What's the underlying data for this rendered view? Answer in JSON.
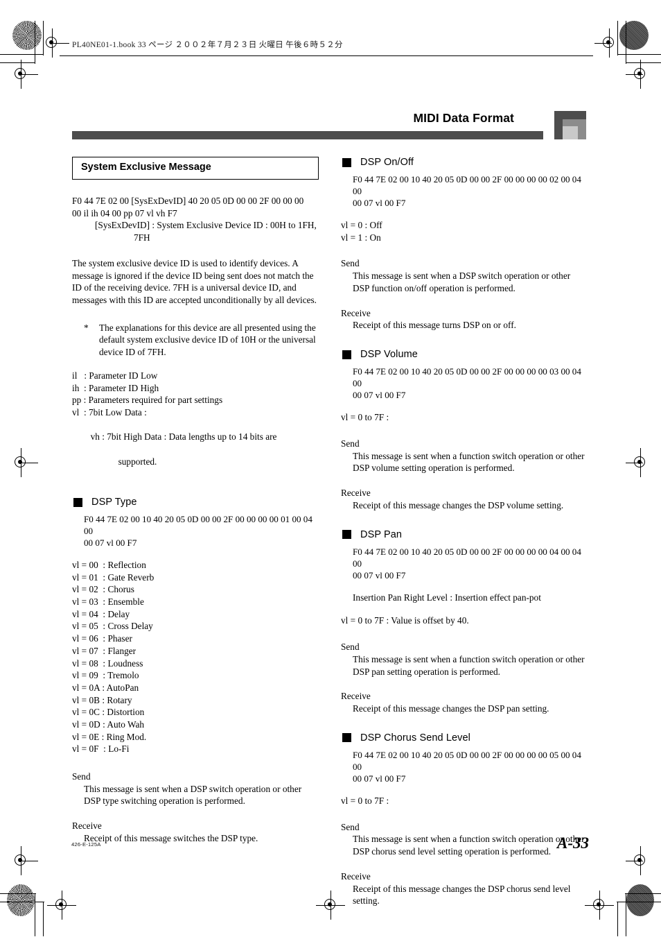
{
  "slug": "PL40NE01-1.book   33 ページ   ２００２年７月２３日   火曜日   午後６時５２分",
  "running_head": {
    "title": "MIDI Data Format"
  },
  "footer": {
    "code": "426-E-125A",
    "page": "A-33"
  },
  "left_column": {
    "section_heading": "System Exclusive Message",
    "sysex_hex_line1": "F0 44 7E 02 00 [SysExDevID] 40 20 05 0D 00 00 2F 00 00 00",
    "sysex_hex_line2": "00 il ih 04 00 pp 07 vl vh F7",
    "devid_line1": "[SysExDevID] : System Exclusive Device ID : 00H to 1FH,",
    "devid_line2": "7FH",
    "description": "The system exclusive device ID is used to identify devices. A message is ignored if the device ID being sent does not match the ID of the receiving device. 7FH is a universal device ID, and messages with this ID are accepted unconditionally by all devices.",
    "note_marker": "*",
    "note_text": "The explanations for this device are all presented using the default system exclusive device ID of 10H or the universal device ID of 7FH.",
    "param_defs": [
      "il   : Parameter ID Low",
      "ih  : Parameter ID High",
      "pp : Parameters required for part settings",
      "vl  : 7bit Low Data :"
    ],
    "param_def_vh_main": "vh : 7bit High Data : Data lengths up to 14 bits are",
    "param_def_vh_cont": "supported.",
    "dsp_type": {
      "heading": "DSP Type",
      "hex_line1": "F0 44 7E 02 00 10 40 20 05 0D 00 00 2F 00 00 00 00 01 00 04 00",
      "hex_line2": "00 07 vl 00 F7",
      "values": [
        "vl = 00  : Reflection",
        "vl = 01  : Gate Reverb",
        "vl = 02  : Chorus",
        "vl = 03  : Ensemble",
        "vl = 04  : Delay",
        "vl = 05  : Cross Delay",
        "vl = 06  : Phaser",
        "vl = 07  : Flanger",
        "vl = 08  : Loudness",
        "vl = 09  : Tremolo",
        "vl = 0A : AutoPan",
        "vl = 0B : Rotary",
        "vl = 0C : Distortion",
        "vl = 0D : Auto Wah",
        "vl = 0E : Ring Mod.",
        "vl = 0F  : Lo-Fi"
      ],
      "send_label": "Send",
      "send_text": "This message is sent when a DSP switch operation or other DSP type switching operation is performed.",
      "receive_label": "Receive",
      "receive_text": "Receipt of this message switches the DSP type."
    }
  },
  "right_column": {
    "dsp_onoff": {
      "heading": "DSP On/Off",
      "hex_line1": "F0 44 7E 02 00 10 40 20 05 0D 00 00 2F 00 00 00 00 02 00 04 00",
      "hex_line2": "00 07 vl 00 F7",
      "values": [
        "vl = 0 : Off",
        "vl = 1 : On"
      ],
      "send_label": "Send",
      "send_text": "This message is sent when a DSP switch operation or other DSP function on/off operation is performed.",
      "receive_label": "Receive",
      "receive_text": "Receipt of this message turns DSP on or off."
    },
    "dsp_volume": {
      "heading": "DSP Volume",
      "hex_line1": "F0 44 7E 02 00 10 40 20 05 0D 00 00 2F 00 00 00 00 03 00 04 00",
      "hex_line2": "00 07 vl 00 F7",
      "values": [
        "vl = 0 to 7F :"
      ],
      "send_label": "Send",
      "send_text": "This message is sent when a function switch operation or other DSP volume setting operation is performed.",
      "receive_label": "Receive",
      "receive_text": "Receipt of this message changes the DSP volume setting."
    },
    "dsp_pan": {
      "heading": "DSP Pan",
      "hex_line1": "F0 44 7E 02 00 10 40 20 05 0D 00 00 2F 00 00 00 00 04 00 04 00",
      "hex_line2": "00 07 vl 00 F7",
      "insertion_note": "Insertion Pan Right Level : Insertion effect pan-pot",
      "values": [
        "vl = 0 to 7F : Value is offset by 40."
      ],
      "send_label": "Send",
      "send_text": "This message is sent when a function switch operation or other DSP pan setting operation is performed.",
      "receive_label": "Receive",
      "receive_text": "Receipt of this message changes the DSP pan setting."
    },
    "dsp_chorus_send_level": {
      "heading": "DSP Chorus Send Level",
      "hex_line1": "F0 44 7E 02 00 10 40 20 05 0D 00 00 2F 00 00 00 00 05 00 04 00",
      "hex_line2": "00 07 vl 00 F7",
      "values": [
        "vl = 0 to 7F :"
      ],
      "send_label": "Send",
      "send_text": "This message is sent when a function switch operation or other DSP chorus send level setting operation is performed.",
      "receive_label": "Receive",
      "receive_text": "Receipt of this message changes the DSP chorus send level setting."
    }
  }
}
